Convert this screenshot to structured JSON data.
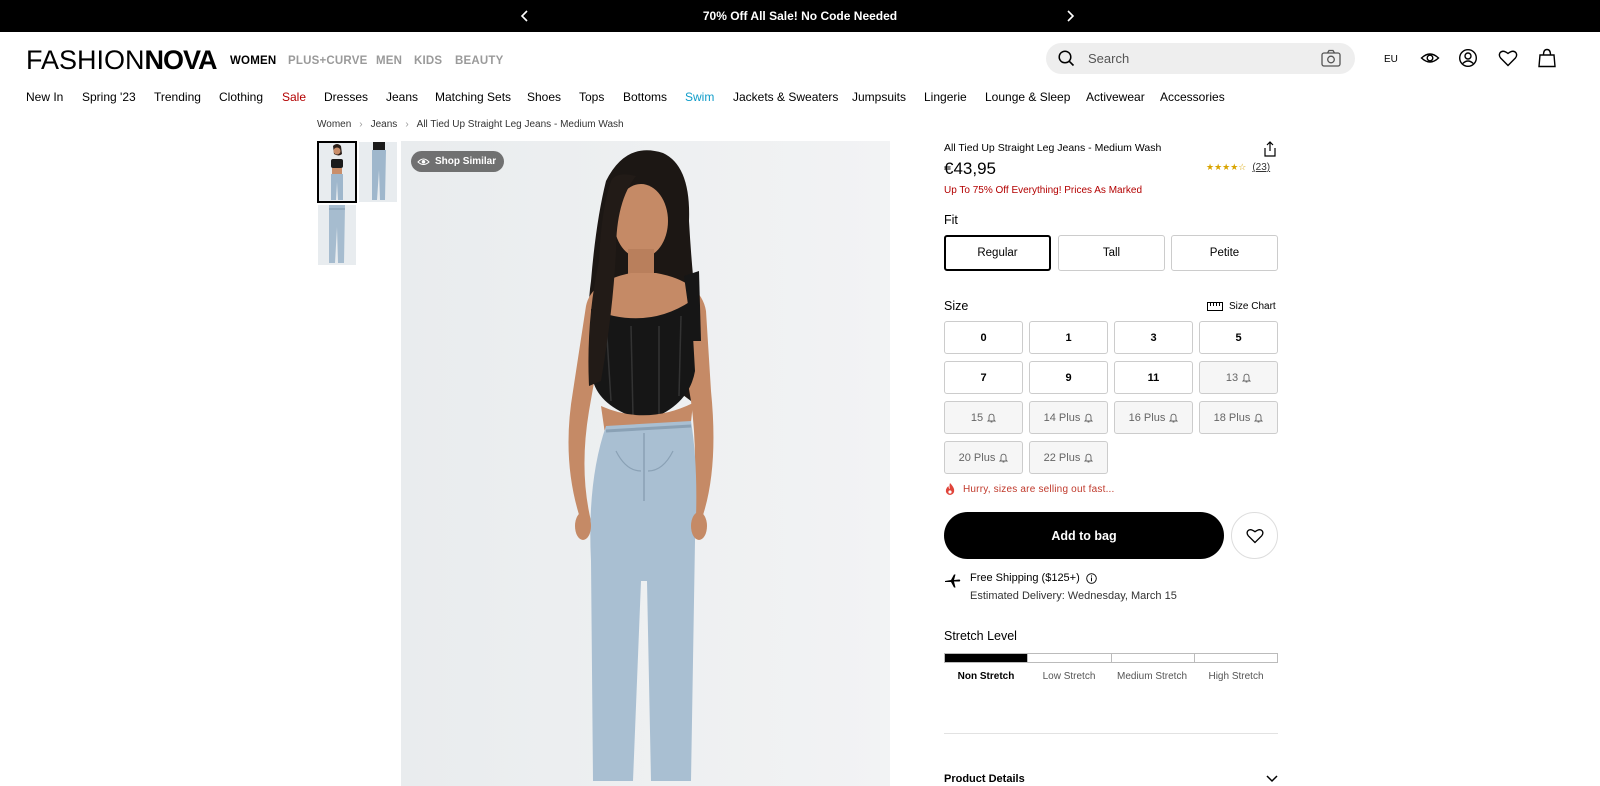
{
  "promo_bar": {
    "message": "70% Off All Sale! No Code Needed",
    "prev_icon": "chevron-left-icon",
    "next_icon": "chevron-right-icon"
  },
  "header": {
    "logo_part1": "FASHION",
    "logo_part2": "NOVA",
    "departments": [
      "WOMEN",
      "PLUS+CURVE",
      "MEN",
      "KIDS",
      "BEAUTY"
    ],
    "active_department": "WOMEN",
    "search_placeholder": "Search",
    "region": "EU",
    "icons": [
      "search-icon",
      "camera-icon",
      "eye-icon",
      "account-icon",
      "heart-icon",
      "bag-icon"
    ]
  },
  "nav": {
    "items": [
      "New In",
      "Spring '23",
      "Trending",
      "Clothing",
      "Sale",
      "Dresses",
      "Jeans",
      "Matching Sets",
      "Shoes",
      "Tops",
      "Bottoms",
      "Swim",
      "Jackets & Sweaters",
      "Jumpsuits",
      "Lingerie",
      "Lounge & Sleep",
      "Activewear",
      "Accessories"
    ],
    "highlight_colors": {
      "Sale": "#b30000",
      "Swim": "#0f9cc9"
    }
  },
  "breadcrumb": [
    "Women",
    "Jeans",
    "All Tied Up Straight Leg Jeans - Medium Wash"
  ],
  "gallery": {
    "shop_similar": "Shop Similar",
    "thumbnail_count": 3,
    "selected_thumbnail": 1
  },
  "product": {
    "title": "All Tied Up Straight Leg Jeans - Medium Wash",
    "price": "€43,95",
    "rating_stars": "★★★★☆",
    "rating": 4,
    "review_count": "(23)",
    "promo_note": "Up To 75% Off Everything! Prices As Marked",
    "fit_label": "Fit",
    "fit_options": [
      "Regular",
      "Tall",
      "Petite"
    ],
    "fit_selected": "Regular",
    "size_label": "Size",
    "size_chart": "Size Chart",
    "sizes": [
      {
        "label": "0",
        "available": true
      },
      {
        "label": "1",
        "available": true
      },
      {
        "label": "3",
        "available": true
      },
      {
        "label": "5",
        "available": true
      },
      {
        "label": "7",
        "available": true
      },
      {
        "label": "9",
        "available": true
      },
      {
        "label": "11",
        "available": true
      },
      {
        "label": "13",
        "available": false
      },
      {
        "label": "15",
        "available": false
      },
      {
        "label": "14 Plus",
        "available": false
      },
      {
        "label": "16 Plus",
        "available": false
      },
      {
        "label": "18 Plus",
        "available": false
      },
      {
        "label": "20 Plus",
        "available": false
      },
      {
        "label": "22 Plus",
        "available": false
      }
    ],
    "hurry_text": "Hurry, sizes are selling out fast...",
    "add_to_bag": "Add to bag",
    "shipping_title": "Free Shipping ($125+)",
    "delivery": "Estimated Delivery: Wednesday, March 15",
    "stretch_label": "Stretch Level",
    "stretch_levels": [
      "Non Stretch",
      "Low Stretch",
      "Medium Stretch",
      "High Stretch"
    ],
    "stretch_selected": "Non Stretch",
    "details_label": "Product Details"
  },
  "colors": {
    "sale_red": "#b30000",
    "swim_blue": "#0f9cc9",
    "hurry_red": "#c0392b",
    "star_gold": "#d9a400"
  }
}
